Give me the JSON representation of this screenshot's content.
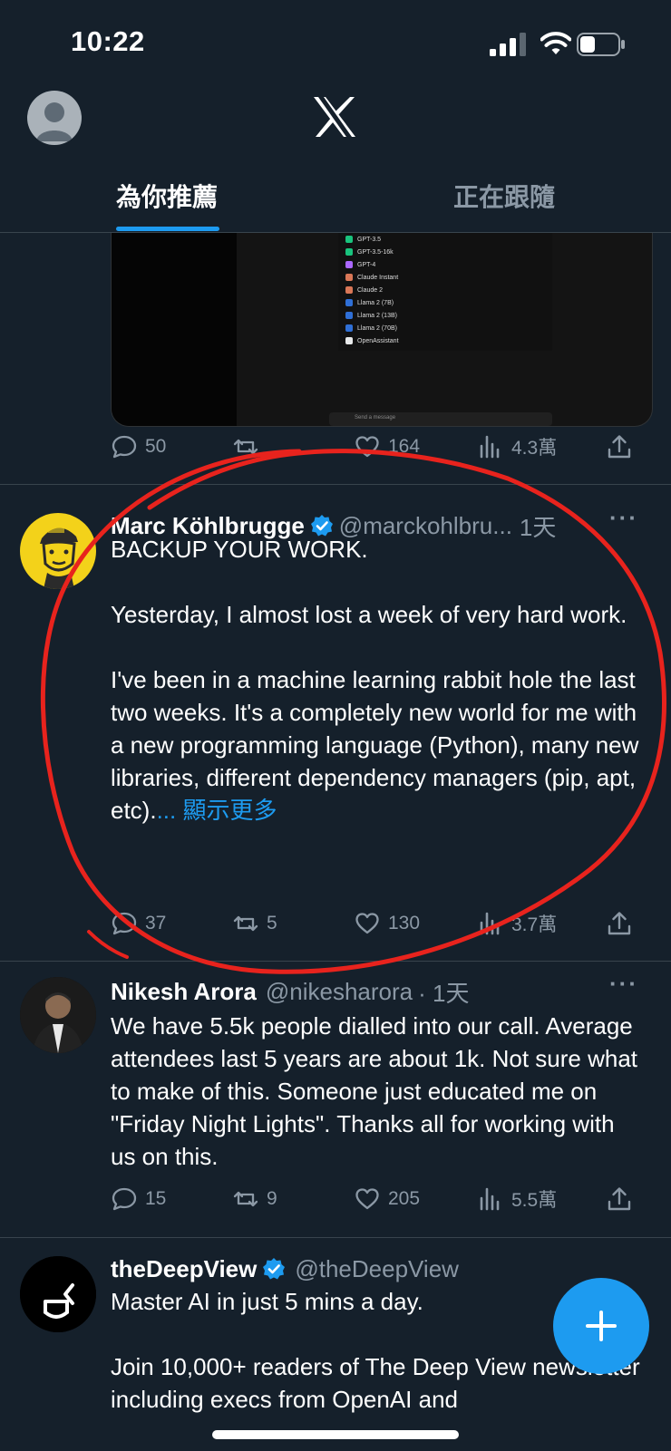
{
  "status_bar": {
    "time": "10:22"
  },
  "tabs": [
    {
      "label": "為你推薦",
      "active": true
    },
    {
      "label": "正在跟隨",
      "active": false
    }
  ],
  "media_menu": {
    "items": [
      "GPT-3.5",
      "GPT-3.5-16k",
      "GPT-4",
      "Claude Instant",
      "Claude 2",
      "Llama 2 (7B)",
      "Llama 2 (13B)",
      "Llama 2 (70B)",
      "OpenAssistant"
    ],
    "send_placeholder": "Send a message"
  },
  "tweets": [
    {
      "actions": {
        "replies": "50",
        "reposts": "",
        "likes": "164",
        "views": "4.3萬"
      }
    },
    {
      "name": "Marc Köhlbrugge",
      "handle": "@marckohlbru...",
      "time": "1天",
      "verified": true,
      "text": "BACKUP YOUR WORK.\n\nYesterday, I almost lost a week of very hard work.\n\nI've been in a machine learning rabbit hole the last two weeks. It's a completely new world for me with a new programming language (Python), many new libraries, different dependency managers (pip, apt, etc).",
      "show_more": "... 顯示更多",
      "actions": {
        "replies": "37",
        "reposts": "5",
        "likes": "130",
        "views": "3.7萬"
      }
    },
    {
      "name": "Nikesh Arora",
      "handle": "@nikesharora",
      "time": "· 1天",
      "verified": false,
      "text": "We have 5.5k people dialled into our call. Average attendees last 5 years are about 1k. Not sure what to make of this. Someone just educated me on \"Friday Night Lights\". Thanks all for working with us on this.",
      "actions": {
        "replies": "15",
        "reposts": "9",
        "likes": "205",
        "views": "5.5萬"
      }
    },
    {
      "name": "theDeepView",
      "handle": "@theDeepView",
      "verified": true,
      "text": "Master AI in just 5 mins a day.\n\nJoin 10,000+ readers of The Deep View newsletter including execs from OpenAI and"
    }
  ],
  "colors": {
    "background": "#15202b",
    "accent": "#1d9bf0",
    "annotation": "#e8231d"
  },
  "icons": [
    "x-logo-icon",
    "reply-icon",
    "repost-icon",
    "like-icon",
    "views-icon",
    "share-icon",
    "verified-icon",
    "compose-plus-icon"
  ]
}
